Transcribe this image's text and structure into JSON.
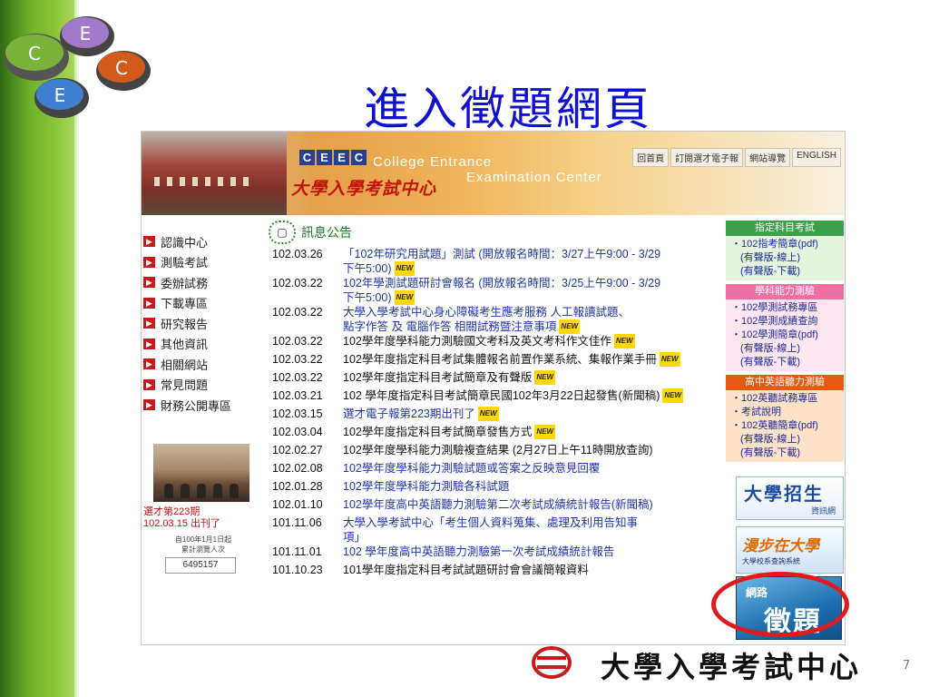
{
  "slide": {
    "title": "進入徵題網頁",
    "page_number": "7",
    "footer_text": "大學入學考試中心",
    "logo_letters": [
      "C",
      "E",
      "E",
      "C"
    ]
  },
  "site": {
    "ceec_letters": [
      "C",
      "E",
      "E",
      "C"
    ],
    "name_en_1": "College Entrance",
    "name_en_2": "Examination Center",
    "name_cn": "大學入學考試中心",
    "top_nav": [
      "回首頁",
      "訂閱選才電子報",
      "網站導覽",
      "ENGLISH"
    ]
  },
  "left_nav": [
    "認識中心",
    "測驗考試",
    "委辦試務",
    "下載專區",
    "研究報告",
    "其他資訊",
    "相關網站",
    "常見問題",
    "財務公開專區"
  ],
  "newsletter_caption": [
    "選才第223期",
    "102.03.15 出刊了"
  ],
  "visitor": {
    "label_1": "自100年1月1日起",
    "label_2": "累計瀏覽人次",
    "count": "6495157"
  },
  "news": {
    "title": "訊息公告",
    "items": [
      {
        "date": "102.03.26",
        "lines": [
          "「102年研究用試題」測試 (開放報名時間：3/27上午9:00 - 3/29",
          "下午5:00)"
        ],
        "new": true,
        "style": "blue"
      },
      {
        "date": "102.03.22",
        "lines": [
          "102年學測試題研討會報名 (開放報名時間：3/25上午9:00 - 3/29",
          "下午5:00)"
        ],
        "new": true,
        "style": "blue"
      },
      {
        "date": "102.03.22",
        "lines": [
          "大學入學考試中心身心障礙考生應考服務 人工報讀試題、",
          "點字作答 及 電腦作答 相關試務暨注意事項"
        ],
        "new": true,
        "style": "blue"
      },
      {
        "date": "102.03.22",
        "lines": [
          "102學年度學科能力測驗國文考科及英文考科作文佳作"
        ],
        "new": true,
        "style": "dark"
      },
      {
        "date": "102.03.22",
        "lines": [
          "102學年度指定科目考試集體報名前置作業系統、集報作業手冊"
        ],
        "new": true,
        "style": "dark"
      },
      {
        "date": "102.03.22",
        "lines": [
          "102學年度指定科目考試簡章及有聲版"
        ],
        "new": true,
        "style": "dark"
      },
      {
        "date": "102.03.21",
        "lines": [
          "102 學年度指定科目考試簡章民國102年3月22日起發售(新聞稿)"
        ],
        "new": true,
        "style": "dark"
      },
      {
        "date": "102.03.15",
        "lines": [
          "選才電子報第223期出刊了"
        ],
        "new": true,
        "style": "blue"
      },
      {
        "date": "102.03.04",
        "lines": [
          "102學年度指定科目考試簡章發售方式"
        ],
        "new": true,
        "style": "dark"
      },
      {
        "date": "102.02.27",
        "lines": [
          "102學年度學科能力測驗複查結果 (2月27日上午11時開放查詢)"
        ],
        "new": false,
        "style": "dark"
      },
      {
        "date": "102.02.08",
        "lines": [
          "102學年度學科能力測驗試題或答案之反映意見回覆"
        ],
        "new": false,
        "style": "blue"
      },
      {
        "date": "102.01.28",
        "lines": [
          "102學年度學科能力測驗各科試題"
        ],
        "new": false,
        "style": "blue"
      },
      {
        "date": "102.01.10",
        "lines": [
          "102學年度高中英語聽力測驗第二次考試成績統計報告(新聞稿)"
        ],
        "new": false,
        "style": "blue"
      },
      {
        "date": "101.11.06",
        "lines": [
          "大學入學考試中心「考生個人資料蒐集、處理及利用告知事",
          "項」"
        ],
        "new": false,
        "style": "blue"
      },
      {
        "date": "101.11.01",
        "lines": [
          "102 學年度高中英語聽力測驗第一次考試成績統計報告"
        ],
        "new": false,
        "style": "blue"
      },
      {
        "date": "101.10.23",
        "lines": [
          "101學年度指定科目考試試題研討會會議簡報資料"
        ],
        "new": false,
        "style": "dark"
      }
    ]
  },
  "right_boxes": [
    {
      "header": "指定科目考試",
      "color": "#3aa14a",
      "bg": "#e6f4de",
      "items": [
        "・102指考簡章(pdf)",
        "(有聲版-線上)",
        "(有聲版-下載)"
      ]
    },
    {
      "header": "學科能力測驗",
      "color": "#ee6fa3",
      "bg": "#fde6ef",
      "items": [
        "・102學測試務專區",
        "・102學測成績查詢",
        "・102學測簡章(pdf)",
        "(有聲版-線上)",
        "(有聲版-下載)"
      ]
    },
    {
      "header": "高中英語聽力測驗",
      "color": "#e35a10",
      "bg": "#fde2c8",
      "items": [
        "・102英聽試務專區",
        "・考試說明",
        "・102英聽簡章(pdf)",
        "(有聲版-線上)",
        "(有聲版-下載)"
      ]
    }
  ],
  "ads": {
    "zhaosheng_title": "大學招生",
    "zhaosheng_sub": "資訊網",
    "manbu_title": "漫步在大學",
    "manbu_sub": "大學校系查詢系統",
    "wangzheng_a": "網路",
    "wangzheng_b": "徵題"
  },
  "colors": {
    "title_blue": "#1010d0",
    "highlight_red": "#e11b1b",
    "news_link": "#2233aa"
  }
}
